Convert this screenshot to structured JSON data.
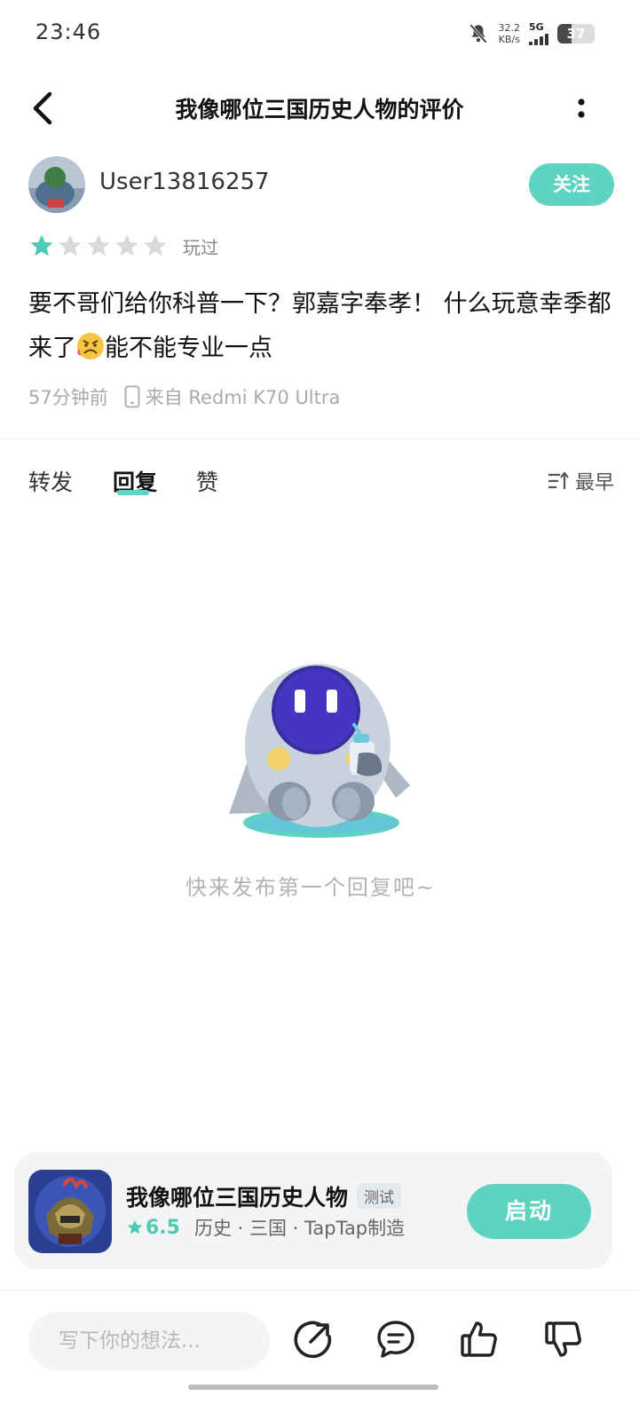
{
  "status_bar": {
    "time": "23:46",
    "net_speed_value": "32.2",
    "net_speed_unit": "KB/s",
    "network": "5G",
    "battery": "37",
    "icons": [
      "bell-muted-icon",
      "signal-icon",
      "battery-icon"
    ]
  },
  "header": {
    "title": "我像哪位三国历史人物的评价",
    "icons": [
      "back-arrow-icon",
      "more-icon"
    ]
  },
  "review": {
    "username": "User13816257",
    "follow_label": "关注",
    "rating_stars": 1,
    "rating_max": 5,
    "played_label": "玩过",
    "content_part1": "要不哥们给你科普一下？郭嘉字奉孝！ 什么玩意幸季都来了",
    "content_part2": "能不能专业一点",
    "emoji": "angry-face-emoji",
    "time_ago": "57分钟前",
    "device": "来自 Redmi K70 Ultra"
  },
  "tabs": {
    "items": [
      {
        "label": "转发"
      },
      {
        "label": "回复"
      },
      {
        "label": "赞"
      }
    ],
    "active_index": 1,
    "sort_label": "最早"
  },
  "empty_state": {
    "text": "快来发布第一个回复吧~"
  },
  "app_card": {
    "name": "我像哪位三国历史人物",
    "badge": "测试",
    "score": "6.5",
    "tags": "历史 · 三国 · TapTap制造",
    "launch_label": "启动"
  },
  "bottom_bar": {
    "input_placeholder": "写下你的想法...",
    "icons": [
      "share-icon",
      "comment-icon",
      "thumbs-up-icon",
      "thumbs-down-icon"
    ]
  },
  "colors": {
    "accent": "#5ed3bf",
    "star_active": "#4fcbb5",
    "star_inactive": "#d9dadb"
  }
}
